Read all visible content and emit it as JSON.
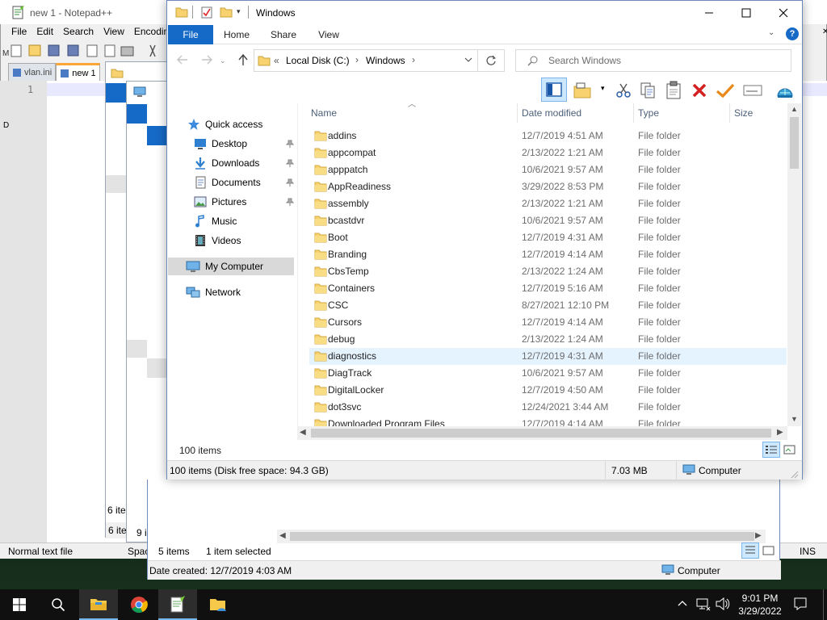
{
  "notepad": {
    "title": "new 1 - Notepad++",
    "menu": [
      "File",
      "Edit",
      "Search",
      "View",
      "Encodin"
    ],
    "tabs": [
      "vlan.ini",
      "new 1"
    ],
    "line_number": "1",
    "status_left": "Normal text file",
    "status_mid": "Spac",
    "status_right": "INS"
  },
  "back_windows": {
    "count_a": "6 ite",
    "count_b": "9 i",
    "partial_letter": "F"
  },
  "explorer2": {
    "items_count": "5 items",
    "selected": "1 item selected",
    "date_created": "Date created: 12/7/2019 4:03 AM",
    "location": "Computer"
  },
  "explorer": {
    "title": "Windows",
    "ribbon_tabs": [
      "File",
      "Home",
      "Share",
      "View"
    ],
    "address": {
      "chevron": "«",
      "parts": [
        "Local Disk (C:)",
        "Windows"
      ]
    },
    "search_placeholder": "Search Windows",
    "nav": {
      "quick_access": "Quick access",
      "items": [
        "Desktop",
        "Downloads",
        "Documents",
        "Pictures",
        "Music",
        "Videos"
      ],
      "my_computer": "My Computer",
      "network": "Network"
    },
    "columns": [
      "Name",
      "Date modified",
      "Type",
      "Size"
    ],
    "rows": [
      {
        "name": "addins",
        "date": "12/7/2019 4:51 AM",
        "type": "File folder"
      },
      {
        "name": "appcompat",
        "date": "2/13/2022 1:21 AM",
        "type": "File folder"
      },
      {
        "name": "apppatch",
        "date": "10/6/2021 9:57 AM",
        "type": "File folder"
      },
      {
        "name": "AppReadiness",
        "date": "3/29/2022 8:53 PM",
        "type": "File folder"
      },
      {
        "name": "assembly",
        "date": "2/13/2022 1:21 AM",
        "type": "File folder"
      },
      {
        "name": "bcastdvr",
        "date": "10/6/2021 9:57 AM",
        "type": "File folder"
      },
      {
        "name": "Boot",
        "date": "12/7/2019 4:31 AM",
        "type": "File folder"
      },
      {
        "name": "Branding",
        "date": "12/7/2019 4:14 AM",
        "type": "File folder"
      },
      {
        "name": "CbsTemp",
        "date": "2/13/2022 1:24 AM",
        "type": "File folder"
      },
      {
        "name": "Containers",
        "date": "12/7/2019 5:16 AM",
        "type": "File folder"
      },
      {
        "name": "CSC",
        "date": "8/27/2021 12:10 PM",
        "type": "File folder"
      },
      {
        "name": "Cursors",
        "date": "12/7/2019 4:14 AM",
        "type": "File folder"
      },
      {
        "name": "debug",
        "date": "2/13/2022 1:24 AM",
        "type": "File folder"
      },
      {
        "name": "diagnostics",
        "date": "12/7/2019 4:31 AM",
        "type": "File folder"
      },
      {
        "name": "DiagTrack",
        "date": "10/6/2021 9:57 AM",
        "type": "File folder"
      },
      {
        "name": "DigitalLocker",
        "date": "12/7/2019 4:50 AM",
        "type": "File folder"
      },
      {
        "name": "dot3svc",
        "date": "12/24/2021 3:44 AM",
        "type": "File folder"
      },
      {
        "name": "Downloaded Program Files",
        "date": "12/7/2019 4:14 AM",
        "type": "File folder"
      }
    ],
    "hovered_row": "diagnostics",
    "items_count": "100 items",
    "details": {
      "disk": "100 items (Disk free space: 94.3 GB)",
      "size": "7.03 MB",
      "location": "Computer"
    }
  },
  "taskbar": {
    "time": "9:01 PM",
    "date": "3/29/2022"
  },
  "colors": {
    "accent": "#1569c7",
    "folder": "#f7d26e",
    "hover_row": "#e5f3ff",
    "taskbar": "#101010"
  }
}
